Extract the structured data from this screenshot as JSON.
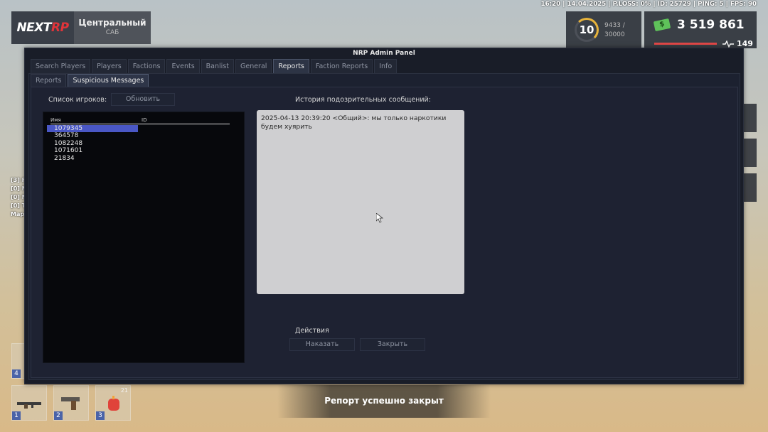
{
  "hud": {
    "status_line": "16:20 | 14.04.2025 | P.LOSS: 0% | ID: 25729 | PING: 5 | FPS: 90",
    "logo_left": "NEXT",
    "logo_right": "RP",
    "district_name": "Центральный",
    "district_sub": "САБ",
    "level": "10",
    "xp_current": "9433 /",
    "xp_max": "30000",
    "money": "3 519 861",
    "health": "149",
    "chat_lines": [
      "[3] F",
      "[0] М",
      "[0] М",
      "[0] Т",
      "Мар"
    ],
    "slots": [
      {
        "num": "1",
        "icon": "rifle-icon"
      },
      {
        "num": "2",
        "icon": "pistol-icon"
      },
      {
        "num": "3",
        "icon": "fruit-icon",
        "count": "21"
      },
      {
        "num": "4",
        "icon": "item-icon"
      }
    ],
    "notification": "Репорт успешно закрыт"
  },
  "panel": {
    "title": "NRP Admin Panel",
    "tabs": [
      "Search Players",
      "Players",
      "Factions",
      "Events",
      "Banlist",
      "General",
      "Reports",
      "Faction Reports",
      "Info"
    ],
    "active_tab": "Reports",
    "subtabs": [
      "Reports",
      "Suspicious Messages"
    ],
    "active_subtab": "Suspicious Messages",
    "players_label": "Список игроков:",
    "refresh_button": "Обновить",
    "list_col_name": "Имя",
    "list_col_id": "ID",
    "players": [
      "1079345",
      "364578",
      "1082248",
      "1071601",
      "21834"
    ],
    "selected_player": "1079345",
    "history_label": "История подозрительных сообщений:",
    "history_text": "2025-04-13 20:39:20 <Общий>: мы только наркотики будем хуярить",
    "actions_label": "Действия",
    "punish_button": "Наказать",
    "close_button": "Закрыть"
  },
  "colors": {
    "panel_bg": "#191d28",
    "selection": "#4a57c5",
    "history_bg": "#cfcfd1",
    "brand_red": "#e0343a",
    "money_green": "#5fc25a"
  }
}
